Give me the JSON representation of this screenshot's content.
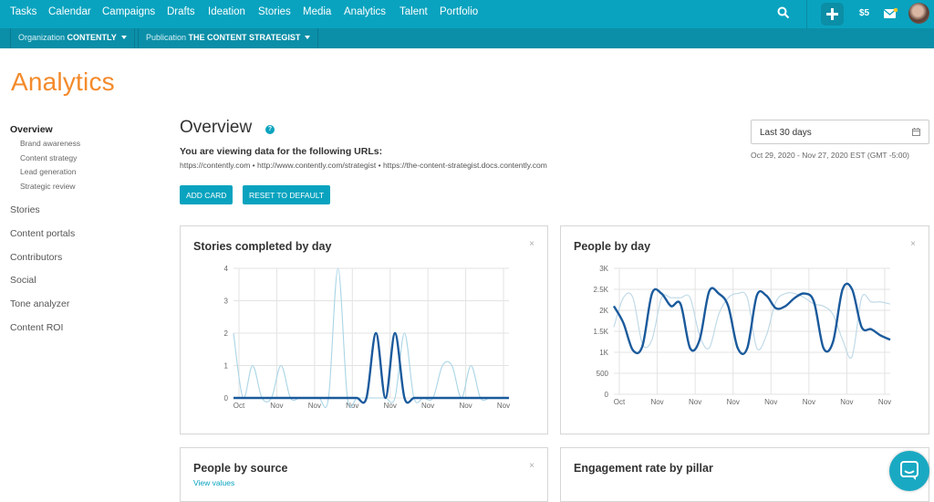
{
  "nav": {
    "items": [
      "Tasks",
      "Calendar",
      "Campaigns",
      "Drafts",
      "Ideation",
      "Stories",
      "Media",
      "Analytics",
      "Talent",
      "Portfolio"
    ],
    "credits": "$5",
    "icons": [
      "search-icon",
      "plus-icon",
      "mail-icon",
      "avatar"
    ]
  },
  "subnav": {
    "org_label": "Organization",
    "org_value": "CONTENTLY",
    "pub_label": "Publication",
    "pub_value": "THE CONTENT STRATEGIST"
  },
  "page": {
    "title": "Analytics"
  },
  "sidebar": {
    "items": [
      {
        "label": "Overview",
        "active": true
      },
      {
        "label": "Brand awareness",
        "sub": true
      },
      {
        "label": "Content strategy",
        "sub": true
      },
      {
        "label": "Lead generation",
        "sub": true
      },
      {
        "label": "Strategic review",
        "sub": true
      },
      {
        "label": "Stories"
      },
      {
        "label": "Content portals"
      },
      {
        "label": "Contributors"
      },
      {
        "label": "Social"
      },
      {
        "label": "Tone analyzer"
      },
      {
        "label": "Content ROI"
      }
    ]
  },
  "overview": {
    "heading": "Overview",
    "help": "?",
    "viewing": "You are viewing data for the following URLs:",
    "urls": "https://contently.com  •  http://www.contently.com/strategist  •  https://the-content-strategist.docs.contently.com",
    "add_card": "ADD CARD",
    "reset": "RESET TO DEFAULT"
  },
  "date": {
    "selected": "Last 30 days",
    "range": "Oct 29, 2020 - Nov 27, 2020 EST (GMT -5:00)"
  },
  "cards": {
    "stories": {
      "title": "Stories completed by day",
      "close": "×"
    },
    "people": {
      "title": "People by day",
      "close": "×"
    },
    "source": {
      "title": "People by source",
      "close": "×",
      "link": "View values"
    },
    "engagement": {
      "title": "Engagement rate by pillar"
    }
  },
  "chart_data": [
    {
      "type": "line",
      "title": "Stories completed by day",
      "x": [
        "Oct",
        "Nov",
        "Nov",
        "Nov",
        "Nov",
        "Nov",
        "Nov",
        "Nov"
      ],
      "ylim": [
        0,
        4
      ],
      "yticks": [
        "0",
        "1",
        "2",
        "3",
        "4"
      ],
      "series": [
        {
          "values": [
            0,
            0,
            0,
            0,
            0,
            0,
            0,
            0,
            0,
            0,
            0,
            0,
            0,
            0,
            0,
            2,
            0,
            2,
            0,
            0,
            0,
            0,
            0,
            0,
            0,
            0,
            0,
            0,
            0,
            0
          ],
          "color": "#1a5a9c"
        },
        {
          "values": [
            2,
            0,
            1,
            0,
            0,
            1,
            0,
            0,
            0,
            0,
            0,
            4,
            0,
            0,
            0,
            0,
            0,
            0,
            2,
            0,
            0,
            0,
            1,
            1,
            0,
            1,
            0,
            0,
            0,
            0
          ],
          "color": "#a9d5e6"
        }
      ]
    },
    {
      "type": "line",
      "title": "People by day",
      "x": [
        "Oct",
        "Nov",
        "Nov",
        "Nov",
        "Nov",
        "Nov",
        "Nov",
        "Nov"
      ],
      "ylim": [
        0,
        3000
      ],
      "yticks": [
        "0",
        "500",
        "1K",
        "1.5K",
        "2K",
        "2.5K",
        "3K"
      ],
      "series": [
        {
          "values": [
            2100,
            1700,
            1050,
            1150,
            2400,
            2400,
            2100,
            2150,
            1100,
            1300,
            2450,
            2400,
            2100,
            1100,
            1100,
            2350,
            2350,
            2050,
            2100,
            2300,
            2400,
            2200,
            1100,
            1250,
            2500,
            2500,
            1600,
            1550,
            1400,
            1300
          ],
          "color": "#1a5a9c"
        },
        {
          "values": [
            1600,
            2300,
            2300,
            1200,
            1300,
            2300,
            2300,
            2300,
            2300,
            1400,
            1100,
            1900,
            2300,
            2400,
            2300,
            1100,
            1400,
            2200,
            2400,
            2400,
            2300,
            2150,
            2100,
            1900,
            1300,
            900,
            2300,
            2200,
            2200,
            2150
          ],
          "color": "#bcd7e6"
        }
      ]
    }
  ]
}
